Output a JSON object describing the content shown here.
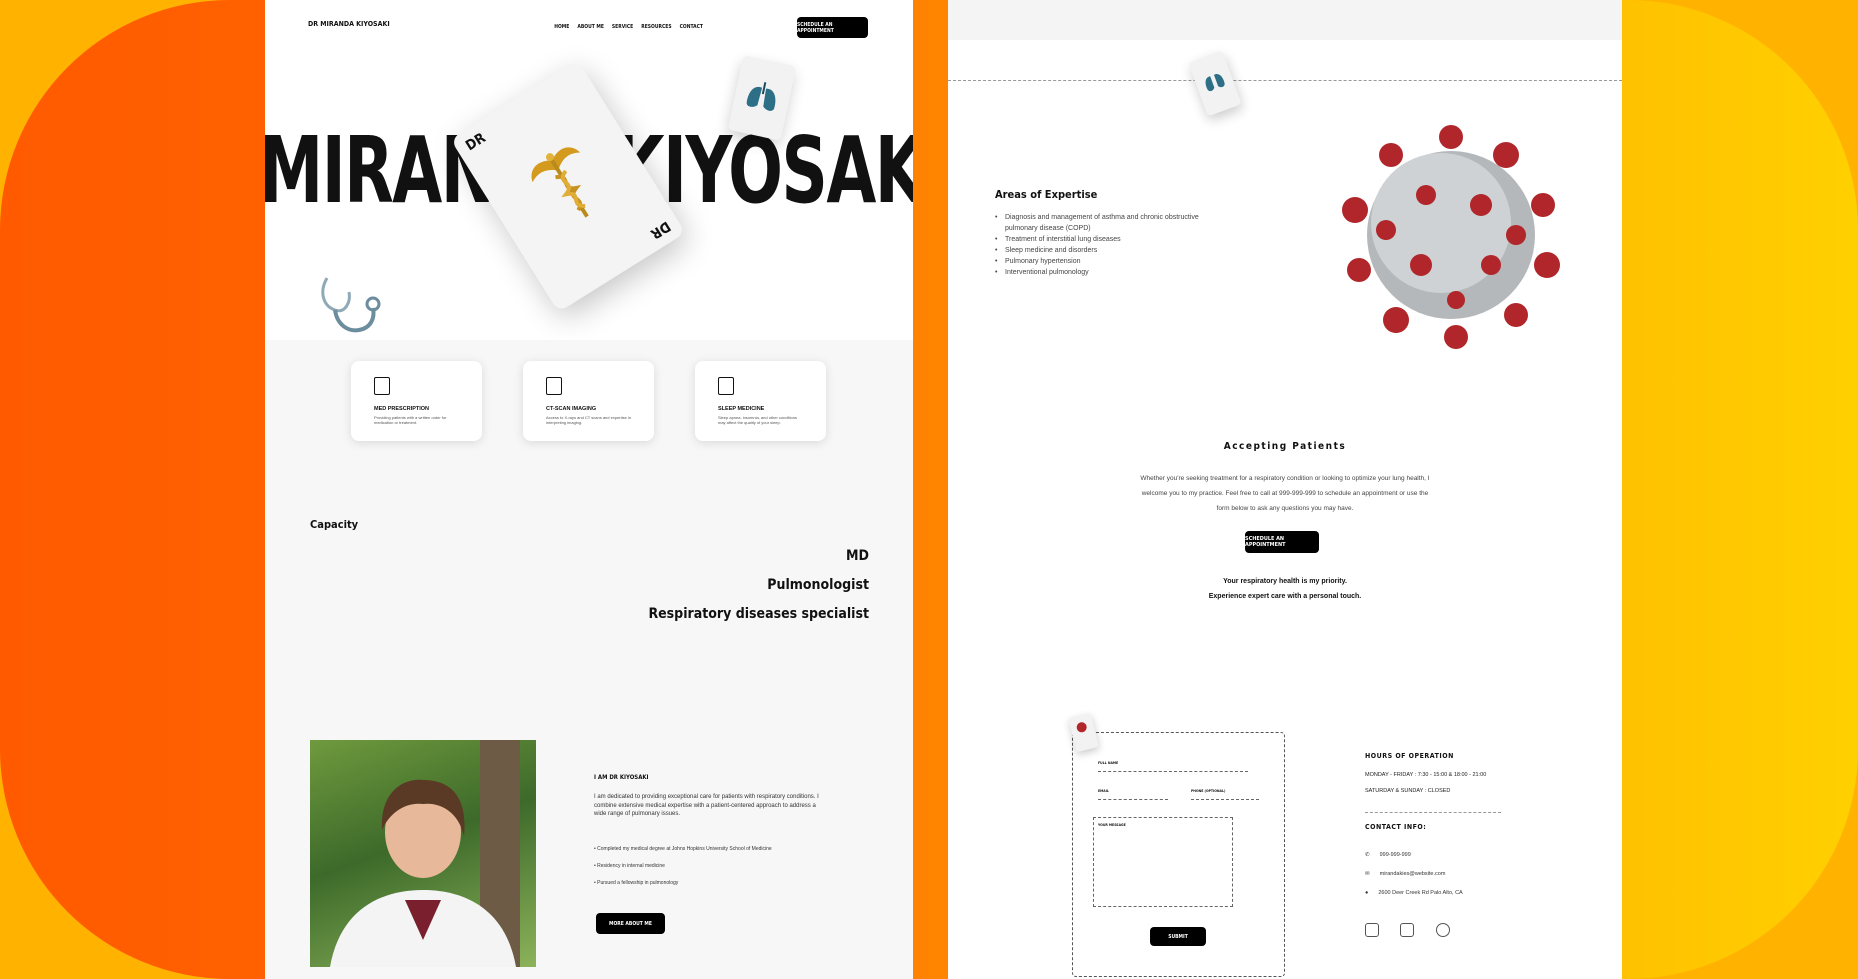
{
  "page1": {
    "brand": "DR MIRANDA KIYOSAKI",
    "nav": [
      "HOME",
      "ABOUT ME",
      "SERVICE",
      "RESOURCES",
      "CONTACT"
    ],
    "nav_cta": "SCHEDULE AN APPOINTMENT",
    "hero_name": "MIRANDA KIYOSAKI",
    "card_label": "DR",
    "services": [
      {
        "title": "MED PRESCRIPTION",
        "desc": "Providing patients with a written order for medication or treatment.",
        "icon": "prescription-icon"
      },
      {
        "title": "CT-SCAN IMAGING",
        "desc": "Access to X-rays and CT scans and expertise in interpreting imaging.",
        "icon": "ct-scan-icon"
      },
      {
        "title": "SLEEP MEDICINE",
        "desc": "Sleep apnea, insomnia, and other conditions may affect the quality of your sleep.",
        "icon": "sleep-monitor-icon"
      }
    ],
    "capacity_title": "Capacity",
    "capacity_items": [
      "MD",
      "Pulmonologist",
      "Respiratory diseases specialist"
    ],
    "about_title": "I AM DR KIYOSAKI",
    "about_text": "I am dedicated to providing exceptional care for patients with respiratory conditions. I combine extensive medical expertise with a patient-centered approach to address a wide range of pulmonary issues.",
    "about_bullets": [
      "Completed my medical degree at Johns Hopkins University School of Medicine",
      "Residency in internal medicine",
      "Pursued a fellowship in pulmonology"
    ],
    "more_button": "MORE ABOUT ME"
  },
  "page2": {
    "areas_title": "Areas of Expertise",
    "areas": [
      "Diagnosis and management of asthma and chronic obstructive pulmonary disease (COPD)",
      "Treatment of interstitial lung diseases",
      "Sleep medicine and disorders",
      "Pulmonary hypertension",
      "Interventional pulmonology"
    ],
    "accepting_title": "Accepting Patients",
    "accepting_text": "Whether you're seeking treatment for a respiratory condition or looking to optimize your lung health, I welcome you to my practice. Feel free to call at 999-999-999 to schedule an appointment or use the form below to ask any questions you may have.",
    "cta": "SCHEDULE AN APPOINTMENT",
    "priority_1": "Your respiratory health is my priority.",
    "priority_2": "Experience expert care with a personal touch.",
    "form": {
      "full_name": "FULL NAME",
      "email": "EMAIL",
      "phone": "PHONE (OPTIONAL)",
      "message": "YOUR MESSAGE",
      "submit": "SUBMIT"
    },
    "hours_title": "HOURS OF OPERATION",
    "hours": [
      "MONDAY - FRIDAY : 7:30 - 15:00 & 18:00 - 21:00",
      "SATURDAY & SUNDAY : CLOSED"
    ],
    "contact_title": "CONTACT INFO:",
    "contact": [
      {
        "icon": "phone-icon",
        "text": "999-999-999"
      },
      {
        "icon": "mail-icon",
        "text": "mirandakies@website.com"
      },
      {
        "icon": "location-icon",
        "text": "2600 Deer Creek Rd Palo Alto, CA"
      }
    ],
    "social": [
      "instagram-icon",
      "linkedin-icon",
      "pinterest-icon"
    ]
  },
  "colors": {
    "accent": "#ff6a00",
    "gradient_end": "#ffd000",
    "button": "#000000"
  }
}
